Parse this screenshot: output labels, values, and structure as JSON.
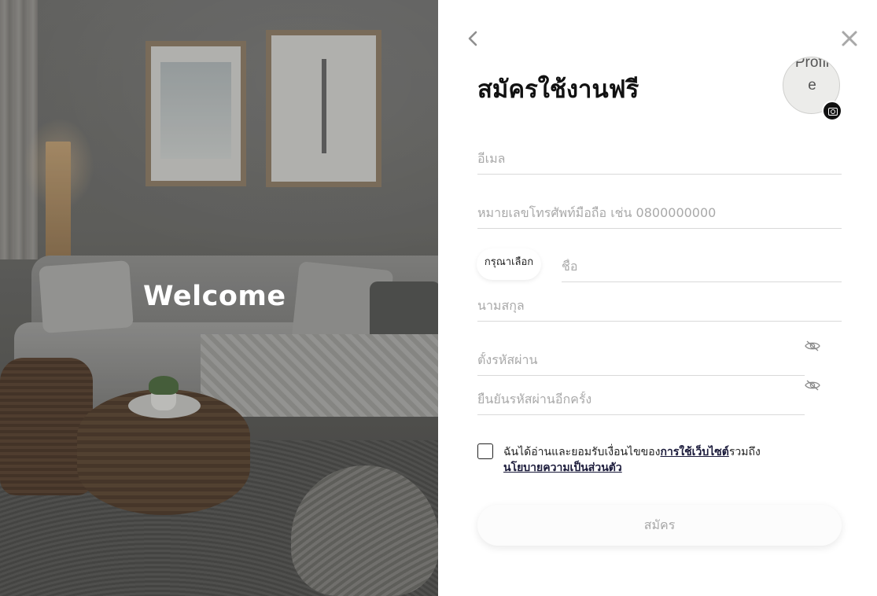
{
  "hero": {
    "welcome_text": "Welcome"
  },
  "nav": {
    "back_icon": "chevron-left-icon",
    "close_icon": "close-icon"
  },
  "form": {
    "title": "สมัครใช้งานฟรี",
    "avatar_alt": "Profile",
    "avatar_camera_icon": "camera-icon",
    "email_placeholder": "อีเมล",
    "phone_placeholder": "หมายเลขโทรศัพท์มือถือ เช่น 0800000000",
    "prefix_select": "กรุณาเลือก",
    "first_name_placeholder": "ชื่อ",
    "last_name_placeholder": "นามสกุล",
    "password_placeholder": "ตั้งรหัสผ่าน",
    "confirm_password_placeholder": "ยืนยันรหัสผ่านอีกครั้ง",
    "password_toggle_icon": "eye-off-icon",
    "terms_prefix": "ฉันได้อ่านและยอมรับเงื่อนไขของ",
    "terms_link": "การใช้เว็บไซต์",
    "terms_middle": "รวมถึง",
    "privacy_link": "นโยบายความเป็นส่วนตัว",
    "submit_label": "สมัคร"
  },
  "colors": {
    "hero_overlay": "#5f5f5c",
    "accent_text": "#111111",
    "placeholder": "#a9a9a9",
    "link": "#1a1a3a"
  }
}
